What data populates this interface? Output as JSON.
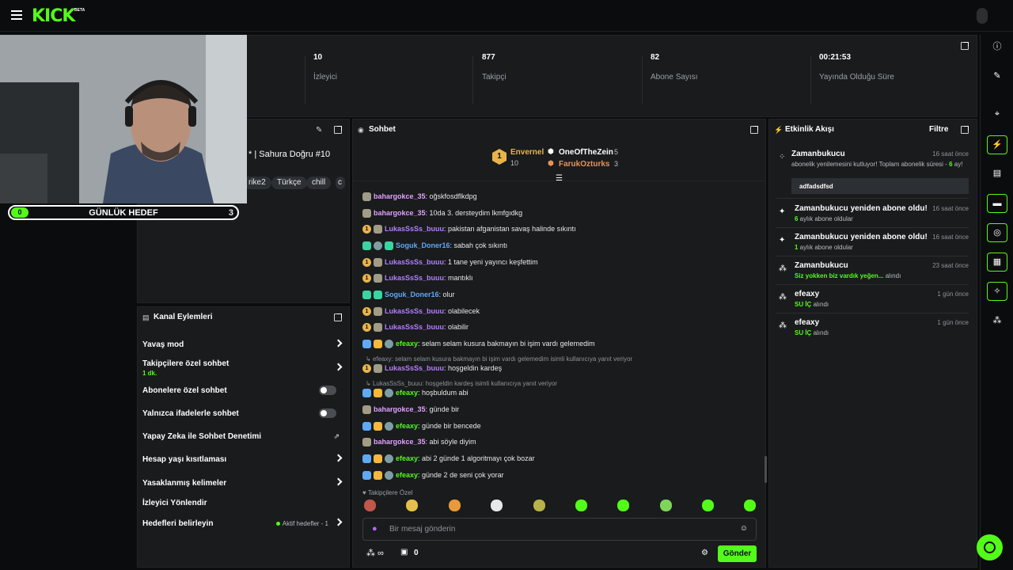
{
  "brand": {
    "logo": "KICK",
    "beta": "BETA"
  },
  "stats": [
    {
      "value": "10",
      "label": "İzleyici"
    },
    {
      "value": "877",
      "label": "Takipçi"
    },
    {
      "value": "82",
      "label": "Abone Sayısı"
    },
    {
      "value": "00:21:53",
      "label": "Yayında Olduğu Süre"
    }
  ],
  "goal": {
    "current": "0",
    "title": "GÜNLÜK HEDEF",
    "target": "3"
  },
  "stream": {
    "title": "* | Sahura Doğru #10",
    "tags": [
      "rike2",
      "Türkçe",
      "chill",
      "c"
    ]
  },
  "actions": {
    "title": "Kanal Eylemleri",
    "items": [
      {
        "label": "Yavaş mod",
        "sub": ""
      },
      {
        "label": "Takipçilere özel sohbet",
        "sub": "1 dk."
      },
      {
        "label": "Abonelere özel sohbet",
        "sub": ""
      },
      {
        "label": "Yalnızca ifadelerle sohbet",
        "sub": ""
      },
      {
        "label": "Yapay Zeka ile Sohbet Denetimi",
        "sub": ""
      },
      {
        "label": "Hesap yaşı kısıtlaması",
        "sub": ""
      },
      {
        "label": "Yasaklanmış kelimeler",
        "sub": ""
      },
      {
        "label": "İzleyici Yönlendir",
        "sub": ""
      },
      {
        "label": "Hedefleri belirleyin",
        "sub": "Aktif hedefler - 1"
      }
    ]
  },
  "chat": {
    "title": "Sohbet",
    "pinned": [
      {
        "name": "Envernel",
        "count": "10"
      },
      {
        "name": "OneOfTheZein",
        "count": "5"
      },
      {
        "name": "FarukOzturks",
        "count": "3"
      }
    ],
    "messages": [
      {
        "user": "bahargokce_35",
        "text": ": oğskfosdflkdpg",
        "color": "#e3a0ff"
      },
      {
        "user": "bahargokce_35",
        "text": ": 10da 3. dersteydim lkmfgıdkg",
        "color": "#e3a0ff"
      },
      {
        "user": "LukasSsSs_buuu",
        "text": ": pakistan afganistan savaş halinde sıkıntı",
        "color": "#b57dff"
      },
      {
        "user": "Soguk_Doner16",
        "text": ": sabah çok sıkıntı",
        "color": "#5fa9f5"
      },
      {
        "user": "LukasSsSs_buuu",
        "text": ": 1 tane yeni yayıncı keşfettim",
        "color": "#b57dff"
      },
      {
        "user": "LukasSsSs_buuu",
        "text": ": mantıklı",
        "color": "#b57dff"
      },
      {
        "user": "Soguk_Doner16",
        "text": ": olur",
        "color": "#5fa9f5"
      },
      {
        "user": "LukasSsSs_buuu",
        "text": ": olabilecek",
        "color": "#b57dff"
      },
      {
        "user": "LukasSsSs_buuu",
        "text": ": olabilir",
        "color": "#b57dff"
      },
      {
        "user": "efeaxy",
        "text": ": selam selam kusura bakmayın bi işim vardı gelemedim",
        "color": "#53fc18"
      },
      {
        "user": "LukasSsSs_buuu",
        "text": ": hoşgeldin kardeş",
        "color": "#b57dff"
      },
      {
        "user": "efeaxy",
        "text": ": hoşbuldum abi",
        "color": "#53fc18"
      },
      {
        "user": "bahargokce_35",
        "text": ": günde bir",
        "color": "#e3a0ff"
      },
      {
        "user": "efeaxy",
        "text": ": günde bir bencede",
        "color": "#53fc18"
      },
      {
        "user": "bahargokce_35",
        "text": ": abi söyle diyim",
        "color": "#e3a0ff"
      },
      {
        "user": "efeaxy",
        "text": ": abi 2 günde 1 algoritmayı çok bozar",
        "color": "#53fc18"
      },
      {
        "user": "efeaxy",
        "text": ": günde 2 de seni çok yorar",
        "color": "#53fc18"
      }
    ],
    "replies": [
      "efeaxy: selam selam kusura bakmayın bi işim vardı gelemedim isimli kullanıcıya yanıt veriyor",
      "LukasSsSs_buuu: hoşgeldin kardeş isimli kullanıcıya yanıt veriyor"
    ],
    "emote_section": "Takipçilere Özel",
    "placeholder": "Bir mesaj gönderin",
    "send": "Gönder",
    "points": "0"
  },
  "feed": {
    "title": "Etkinlik Akışı",
    "filter": "Filtre",
    "items": [
      {
        "name": "Zamanbukucu",
        "time": "16 saat önce",
        "desc": "abonelik yenilemesini kutluyor! Toplam abonelik süresi - ",
        "hl": "6",
        "desc2": " ay!",
        "note": "adfadsdfsd"
      },
      {
        "name": "Zamanbukucu yeniden abone oldu!",
        "time": "16 saat önce",
        "hl": "6",
        "desc": " aylık abone oldular"
      },
      {
        "name": "Zamanbukucu yeniden abone oldu!",
        "time": "16 saat önce",
        "hl": "1",
        "desc": " aylık abone oldular"
      },
      {
        "name": "Zamanbukucu",
        "time": "23 saat önce",
        "hl": "Siz yokken biz vardık yeğen...",
        "desc": " alındı"
      },
      {
        "name": "efeaxy",
        "time": "1 gün önce",
        "hl": "SU İÇ",
        "desc": " alındı"
      },
      {
        "name": "efeaxy",
        "time": "1 gün önce",
        "hl": "SU İÇ",
        "desc": " alındı"
      }
    ]
  }
}
